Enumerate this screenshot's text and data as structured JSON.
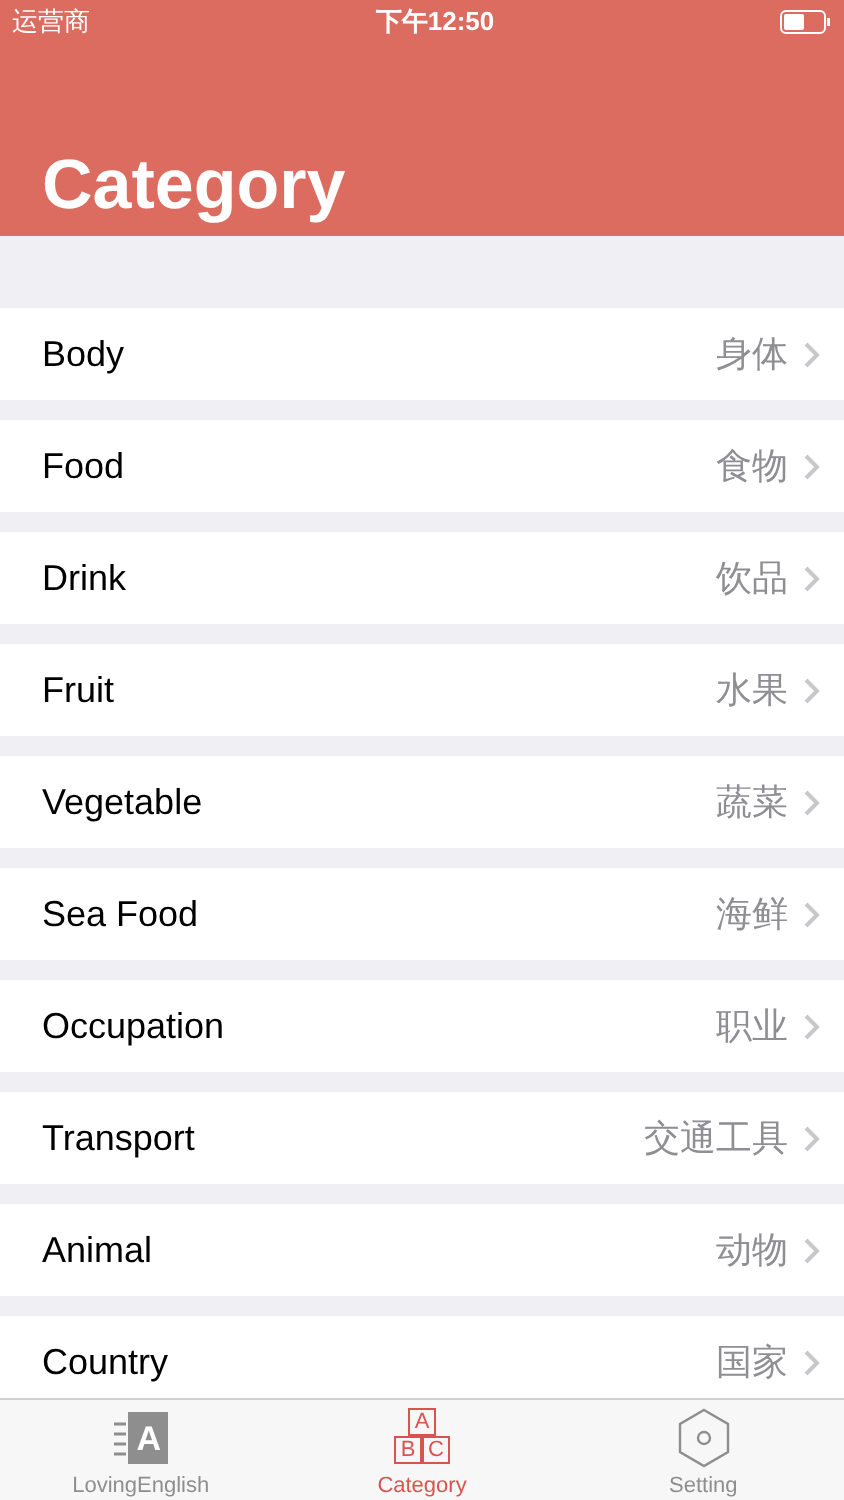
{
  "status_bar": {
    "carrier": "运营商",
    "time": "下午12:50"
  },
  "header": {
    "title": "Category"
  },
  "rows": [
    {
      "label": "Body",
      "chinese": "身体"
    },
    {
      "label": "Food",
      "chinese": "食物"
    },
    {
      "label": "Drink",
      "chinese": "饮品"
    },
    {
      "label": "Fruit",
      "chinese": "水果"
    },
    {
      "label": "Vegetable",
      "chinese": "蔬菜"
    },
    {
      "label": "Sea Food",
      "chinese": "海鲜"
    },
    {
      "label": "Occupation",
      "chinese": "职业"
    },
    {
      "label": "Transport",
      "chinese": "交通工具"
    },
    {
      "label": "Animal",
      "chinese": "动物"
    },
    {
      "label": "Country",
      "chinese": "国家"
    }
  ],
  "tab_bar": [
    {
      "kind": "book",
      "label": "LovingEnglish",
      "icon_letters": [
        "A"
      ],
      "selected": false
    },
    {
      "kind": "blocks",
      "label": "Category",
      "icon_letters": [
        "A",
        "B",
        "C"
      ],
      "selected": true
    },
    {
      "kind": "hexagon",
      "label": "Setting",
      "selected": false
    }
  ]
}
